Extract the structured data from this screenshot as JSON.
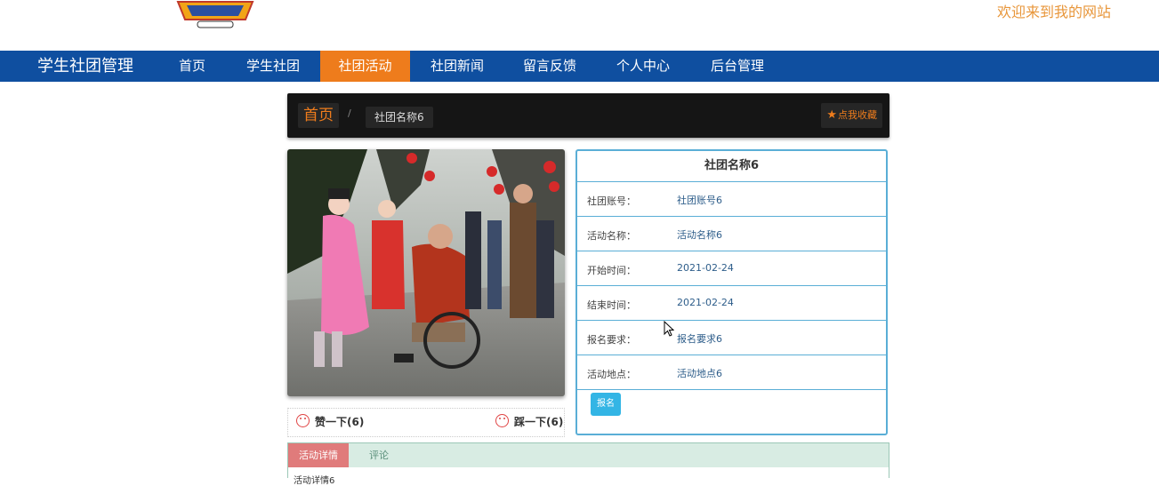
{
  "header": {
    "logo_icon": "digimon-logo",
    "welcome": "欢迎来到我的网站"
  },
  "nav": {
    "brand": "学生社团管理",
    "items": [
      {
        "label": "首页",
        "active": false
      },
      {
        "label": "学生社团",
        "active": false
      },
      {
        "label": "社团活动",
        "active": true
      },
      {
        "label": "社团新闻",
        "active": false
      },
      {
        "label": "留言反馈",
        "active": false
      },
      {
        "label": "个人中心",
        "active": false
      },
      {
        "label": "后台管理",
        "active": false
      }
    ]
  },
  "breadcrumb": {
    "home": "首页",
    "separator": "/",
    "current": "社团名称6",
    "favorite": "点我收藏"
  },
  "votes": {
    "like": "赞一下(6)",
    "dislike": "踩一下(6)"
  },
  "info": {
    "title": "社团名称6",
    "rows": [
      {
        "label": "社团账号：",
        "value": "社团账号6"
      },
      {
        "label": "活动名称：",
        "value": "活动名称6"
      },
      {
        "label": "开始时间：",
        "value": "2021-02-24"
      },
      {
        "label": "结束时间：",
        "value": "2021-02-24"
      },
      {
        "label": "报名要求：",
        "value": "报名要求6"
      },
      {
        "label": "活动地点：",
        "value": "活动地点6"
      }
    ],
    "signup": "报名"
  },
  "tabs": {
    "items": [
      "活动详情",
      "评论"
    ],
    "active": 0,
    "body_text": "活动详情6"
  },
  "colors": {
    "nav_bg": "#0f4fa0",
    "nav_active": "#ee7c1c",
    "accent_orange": "#ee7c1c",
    "table_border": "#5aaed6",
    "signup_bg": "#33b5e5"
  }
}
